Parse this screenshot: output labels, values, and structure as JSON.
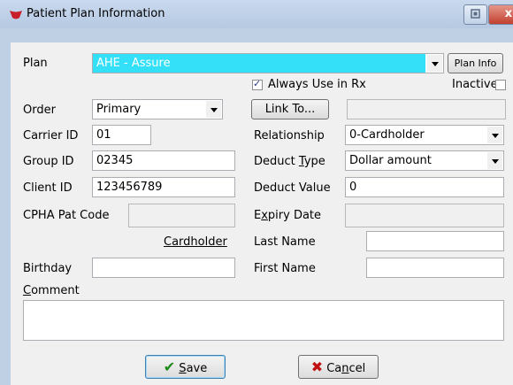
{
  "window": {
    "title": "Patient Plan Information",
    "close_glyph": "x"
  },
  "plan": {
    "label": "Plan",
    "value": "AHE - Assure",
    "info_button": "Plan Info",
    "highlight_color": "#33e0f7"
  },
  "always_use": {
    "label": "Always Use in Rx",
    "checked": true
  },
  "inactive": {
    "label": "Inactive",
    "checked": false
  },
  "order": {
    "label": "Order",
    "value": "Primary"
  },
  "link_button": "Link To...",
  "carrier_id": {
    "label": "Carrier ID",
    "value": "01"
  },
  "group_id": {
    "label": "Group ID",
    "value": "02345"
  },
  "client_id": {
    "label": "Client ID",
    "value": "123456789"
  },
  "cpha_pat_code": {
    "label": "CPHA Pat Code",
    "value": ""
  },
  "cardholder_link": "Cardholder",
  "birthday": {
    "label": "Birthday",
    "value": ""
  },
  "relationship": {
    "label": "Relationship",
    "value": "0-Cardholder"
  },
  "deduct_type": {
    "label_pre": "Deduct ",
    "label_ul": "T",
    "label_post": "ype",
    "value": "Dollar amount"
  },
  "deduct_value": {
    "label": "Deduct Value",
    "value": "0"
  },
  "expiry_date": {
    "label_pre": "E",
    "label_ul": "x",
    "label_post": "piry Date",
    "value": ""
  },
  "last_name": {
    "label": "Last Name",
    "value": ""
  },
  "first_name": {
    "label": "First Name",
    "value": ""
  },
  "comment": {
    "label_ul": "C",
    "label_post": "omment",
    "value": ""
  },
  "save_button": {
    "label_ul": "S",
    "label_post": "ave"
  },
  "cancel_button": {
    "label_pre": "Ca",
    "label_ul": "n",
    "label_post": "cel"
  }
}
